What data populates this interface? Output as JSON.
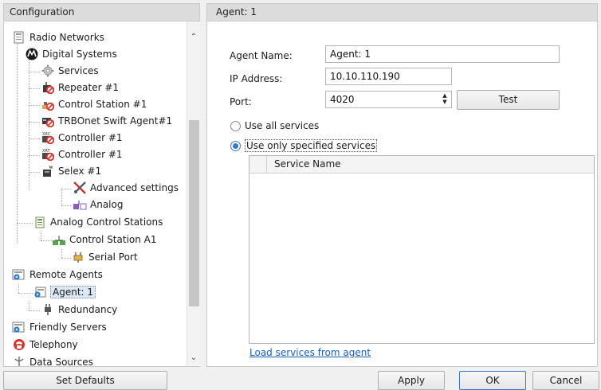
{
  "left_panel": {
    "header": "Configuration",
    "tree": [
      {
        "label": "Radio Networks",
        "icon": "radio-networks-icon"
      },
      {
        "label": "Digital Systems",
        "icon": "motorola-logo-icon"
      },
      {
        "label": "Services",
        "icon": "gear-icon"
      },
      {
        "label": "Repeater #1",
        "icon": "repeater-disabled-icon"
      },
      {
        "label": "Control Station #1",
        "icon": "control-station-disabled-icon"
      },
      {
        "label": "TRBOnet Swift Agent#1",
        "icon": "swift-agent-disabled-icon"
      },
      {
        "label": "Controller #1",
        "icon": "xrc-controller-disabled-icon"
      },
      {
        "label": "Controller #1",
        "icon": "xrt-controller-disabled-icon"
      },
      {
        "label": "Selex #1",
        "icon": "selex-icon"
      },
      {
        "label": "Advanced settings",
        "icon": "tools-icon"
      },
      {
        "label": "Analog",
        "icon": "analog-icon"
      },
      {
        "label": "Analog Control Stations",
        "icon": "analog-control-stations-icon"
      },
      {
        "label": "Control Station A1",
        "icon": "control-station-icon"
      },
      {
        "label": "Serial Port",
        "icon": "serial-port-icon"
      },
      {
        "label": "Remote Agents",
        "icon": "remote-agents-icon"
      },
      {
        "label": "Agent: 1",
        "icon": "agent-icon"
      },
      {
        "label": "Redundancy",
        "icon": "plug-icon"
      },
      {
        "label": "Friendly Servers",
        "icon": "friendly-servers-icon"
      },
      {
        "label": "Telephony",
        "icon": "telephone-icon"
      },
      {
        "label": "Data Sources",
        "icon": "data-sources-icon"
      }
    ]
  },
  "right_panel": {
    "header": "Agent: 1",
    "agent_name_label": "Agent Name:",
    "agent_name_value": "Agent: 1",
    "ip_label": "IP Address:",
    "ip_value": "10.10.110.190",
    "port_label": "Port:",
    "port_value": "4020",
    "test_button": "Test",
    "use_all_label": "Use all services",
    "use_specified_label": "Use only specified services",
    "selected_option": "use_specified",
    "grid_column": "Service Name",
    "load_link": "Load services from agent"
  },
  "bottom": {
    "set_defaults": "Set Defaults",
    "apply": "Apply",
    "ok": "OK",
    "cancel": "Cancel"
  },
  "colors": {
    "accent": "#3a79c8",
    "link": "#1a5fb4",
    "disabled_red": "#d6332b",
    "motorola": "#1b1b1b"
  }
}
